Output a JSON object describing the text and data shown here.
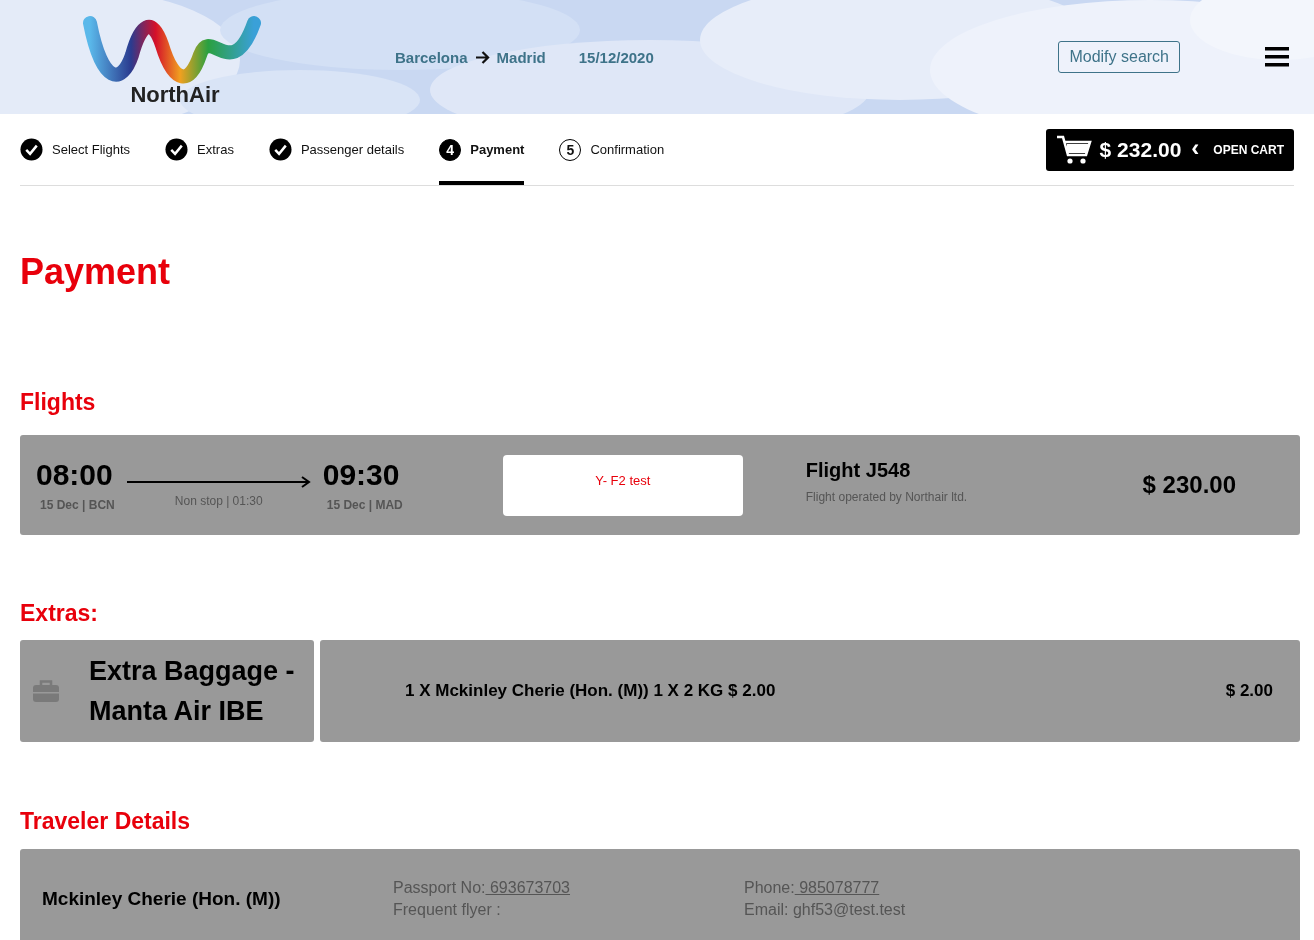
{
  "header": {
    "logo_text": "NorthAir",
    "origin": "Barcelona",
    "destination": "Madrid",
    "date": "15/12/2020",
    "modify_button": "Modify search"
  },
  "steps": [
    {
      "label": "Select Flights",
      "completed": true,
      "selected": false
    },
    {
      "label": "Extras",
      "completed": true,
      "selected": false
    },
    {
      "label": "Passenger details",
      "completed": true,
      "selected": false
    },
    {
      "label": "Payment",
      "completed": false,
      "selected": true,
      "number": "4"
    },
    {
      "label": "Confirmation",
      "completed": false,
      "selected": false,
      "number": "5"
    }
  ],
  "cart": {
    "total": "$ 232.00",
    "chevron": "‹",
    "label": "OPEN CART"
  },
  "page_title": "Payment",
  "flights": {
    "heading": "Flights",
    "items": [
      {
        "depart_time": "08:00",
        "depart_info": "15 Dec | BCN",
        "duration": "Non stop | 01:30",
        "arrive_time": "09:30",
        "arrive_info": "15 Dec | MAD",
        "fare": "Y- F2 test",
        "flight_number": "Flight J548",
        "operator": "Flight operated by Northair ltd.",
        "price": "$ 230.00"
      }
    ]
  },
  "extras": {
    "heading": "Extras:",
    "items": [
      {
        "title": "Extra Baggage - Manta Air IBE",
        "description": "1 X Mckinley Cherie (Hon. (M)) 1 X 2 KG $ 2.00",
        "price": "$ 2.00"
      }
    ]
  },
  "travelers": {
    "heading": "Traveler Details",
    "items": [
      {
        "name": "Mckinley Cherie (Hon. (M))",
        "passport_label": "Passport No:",
        "passport": " 693673703",
        "frequent_flyer": "Frequent flyer :",
        "phone_label": "Phone:",
        "phone": " 985078777",
        "email": "Email: ghf53@test.test"
      }
    ]
  }
}
